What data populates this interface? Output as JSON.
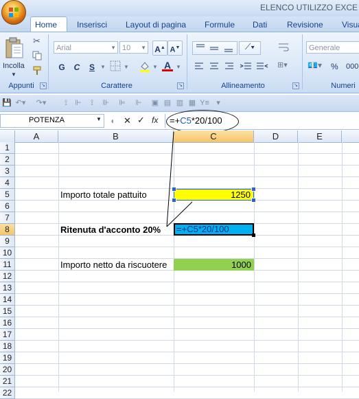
{
  "window": {
    "title": "ELENCO UTILIZZO EXCE"
  },
  "tabs": [
    "Home",
    "Inserisci",
    "Layout di pagina",
    "Formule",
    "Dati",
    "Revisione",
    "Visua"
  ],
  "ribbon": {
    "clipboard": {
      "label": "Appunti",
      "paste_label": "Incolla"
    },
    "font": {
      "label": "Carattere",
      "font_name": "Arial",
      "font_size": "10",
      "bold": "G",
      "italic": "C",
      "underline": "S"
    },
    "alignment": {
      "label": "Allineamento"
    },
    "number": {
      "label": "Numeri",
      "format": "Generale",
      "percent": "%",
      "thousands": "000"
    }
  },
  "formula_bar": {
    "name_box": "POTENZA",
    "fx_label": "fx",
    "formula_prefix": "=+",
    "formula_ref": "C5",
    "formula_suffix": "*20/100"
  },
  "columns": [
    "A",
    "B",
    "C",
    "D",
    "E"
  ],
  "rows": [
    "1",
    "2",
    "3",
    "4",
    "5",
    "6",
    "7",
    "8",
    "9",
    "10",
    "11",
    "12",
    "13",
    "14",
    "15",
    "16",
    "17",
    "18",
    "19",
    "20",
    "21",
    "22"
  ],
  "cells": {
    "b5": "Importo totale pattuito",
    "c5": "1250",
    "b8": "Ritenuta d'acconto 20%",
    "c8_prefix": "=+",
    "c8_ref": "C5",
    "c8_suffix": "*20/100",
    "b11": "Importo netto da riscuotere",
    "c11": "1000"
  },
  "colors": {
    "c5_fill": "#ffff00",
    "c8_fill": "#00b0f0",
    "c11_fill": "#92d050",
    "selected_header": "#f5c469"
  }
}
